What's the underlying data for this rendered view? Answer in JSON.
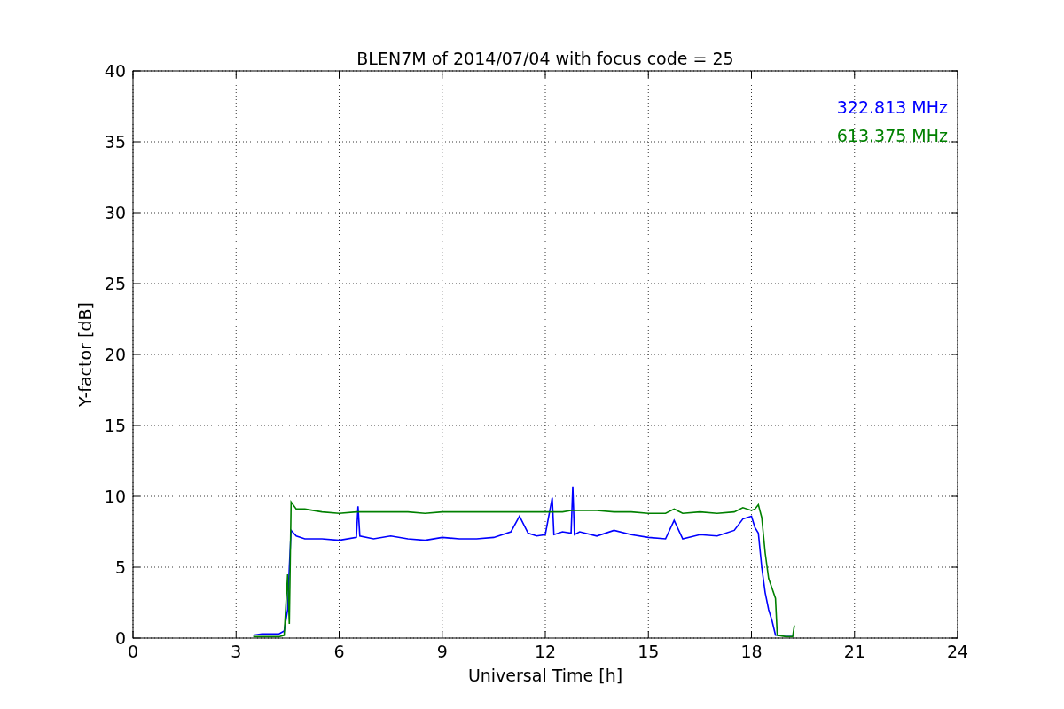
{
  "chart_data": {
    "type": "line",
    "title": "BLEN7M of 2014/07/04 with focus code = 25",
    "xlabel": "Universal Time [h]",
    "ylabel": "Y-factor [dB]",
    "xlim": [
      0,
      24
    ],
    "ylim": [
      0,
      40
    ],
    "xticks": [
      0,
      3,
      6,
      9,
      12,
      15,
      18,
      21,
      24
    ],
    "yticks": [
      0,
      5,
      10,
      15,
      20,
      25,
      30,
      35,
      40
    ],
    "grid": true,
    "x": [
      3.5,
      3.75,
      4.0,
      4.25,
      4.4,
      4.5,
      4.55,
      4.6,
      4.75,
      5,
      5.5,
      6,
      6.5,
      6.55,
      6.6,
      7,
      7.5,
      8,
      8.5,
      9,
      9.5,
      10,
      10.5,
      11,
      11.25,
      11.5,
      11.75,
      12,
      12.2,
      12.25,
      12.5,
      12.75,
      12.8,
      12.85,
      13,
      13.5,
      14,
      14.5,
      15,
      15.5,
      15.75,
      16,
      16.5,
      17,
      17.5,
      17.75,
      18,
      18.1,
      18.2,
      18.3,
      18.4,
      18.5,
      18.6,
      18.7,
      18.75,
      19,
      19.2,
      19.25
    ],
    "series": [
      {
        "name": "322.813 MHz",
        "color": "#0000ff",
        "values": [
          0.2,
          0.3,
          0.3,
          0.3,
          0.5,
          2,
          5,
          7.6,
          7.2,
          7,
          7,
          6.9,
          7.1,
          9.3,
          7.2,
          7,
          7.2,
          7,
          6.9,
          7.1,
          7,
          7,
          7.1,
          7.5,
          8.6,
          7.4,
          7.2,
          7.3,
          9.9,
          7.3,
          7.5,
          7.4,
          10.7,
          7.3,
          7.5,
          7.2,
          7.6,
          7.3,
          7.1,
          7,
          8.3,
          7,
          7.3,
          7.2,
          7.6,
          8.4,
          8.6,
          7.8,
          7.4,
          5,
          3.2,
          2,
          1.2,
          0.2,
          0.2,
          0.2,
          0.2,
          0.2
        ]
      },
      {
        "name": "613.375 MHz",
        "color": "#008000",
        "values": [
          0.1,
          0.1,
          0.1,
          0.1,
          0.2,
          4.5,
          1,
          9.6,
          9.1,
          9.1,
          8.9,
          8.8,
          8.9,
          8.9,
          8.9,
          8.9,
          8.9,
          8.9,
          8.8,
          8.9,
          8.9,
          8.9,
          8.9,
          8.9,
          8.9,
          8.9,
          8.9,
          8.9,
          8.9,
          8.9,
          8.9,
          9.0,
          9.0,
          9.0,
          9.0,
          9.0,
          8.9,
          8.9,
          8.8,
          8.8,
          9.1,
          8.8,
          8.9,
          8.8,
          8.9,
          9.2,
          9.0,
          9.1,
          9.4,
          8.5,
          6,
          4.2,
          3.5,
          2.8,
          0.2,
          0.1,
          0.1,
          0.9
        ]
      }
    ]
  }
}
